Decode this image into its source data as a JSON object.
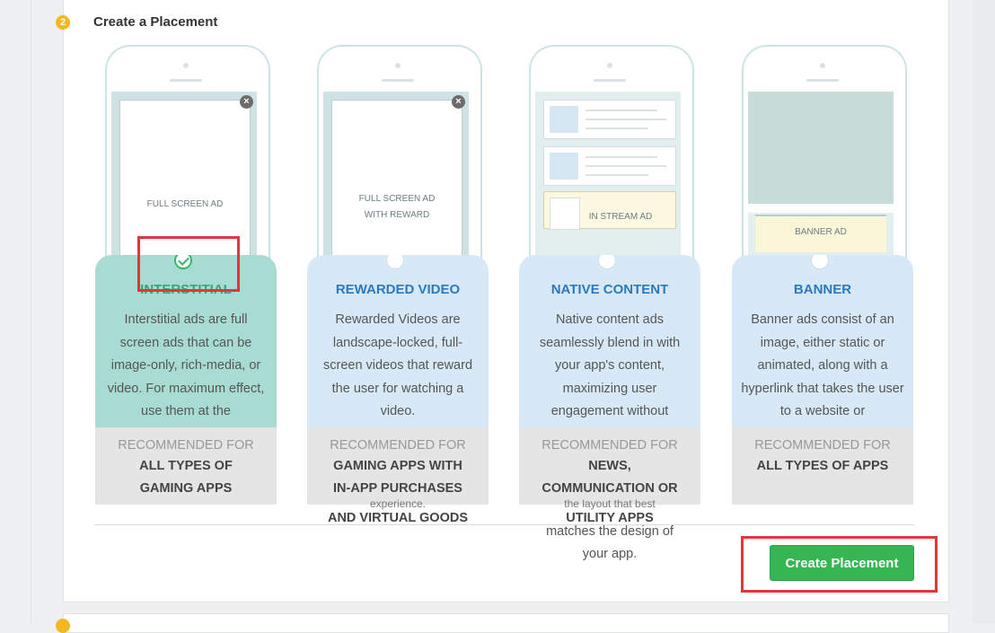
{
  "step": {
    "number": "2",
    "title": "Create a Placement"
  },
  "cards": [
    {
      "screen_label": "FULL SCREEN AD",
      "title": "INTERSTITIAL",
      "description": "Interstitial ads are full screen ads that can be image-only, rich-media, or video. For maximum effect, use them at the",
      "recommended_label": "RECOMMENDED FOR",
      "recommended_line1": "ALL TYPES OF",
      "recommended_line2": "GAMING APPS",
      "selected": true
    },
    {
      "screen_label_line1": "FULL SCREEN AD",
      "screen_label_line2": "WITH REWARD",
      "title": "REWARDED VIDEO",
      "description": "Rewarded Videos are landscape-locked, full-screen videos that reward the user for watching a video.",
      "overflow": "experience.",
      "recommended_label": "RECOMMENDED FOR",
      "recommended_line1": "GAMING APPS WITH",
      "recommended_line2": "IN-APP PURCHASES",
      "recommended_line3": "AND VIRTUAL GOODS",
      "selected": false
    },
    {
      "screen_label": "IN STREAM AD",
      "title": "NATIVE CONTENT",
      "description": "Native content ads seamlessly blend in with your app's content, maximizing user engagement without",
      "overflow_line1": "the layout that best",
      "overflow_line2": "matches the design of",
      "overflow_line3": "your app.",
      "recommended_label": "RECOMMENDED FOR",
      "recommended_line1": "NEWS,",
      "recommended_line2": "COMMUNICATION OR",
      "recommended_line3": "UTILITY APPS",
      "selected": false
    },
    {
      "screen_label": "BANNER AD",
      "title": "BANNER",
      "description": "Banner ads consist of an image, either static or animated, along with a hyperlink that takes the user to a website or",
      "recommended_label": "RECOMMENDED FOR",
      "recommended_line1": "ALL TYPES OF APPS",
      "selected": false
    }
  ],
  "create_button": "Create Placement",
  "colors": {
    "accent_green": "#36b653",
    "badge_yellow": "#f5b721",
    "title_blue": "#2a79c1",
    "highlight_red": "#e5343a"
  }
}
